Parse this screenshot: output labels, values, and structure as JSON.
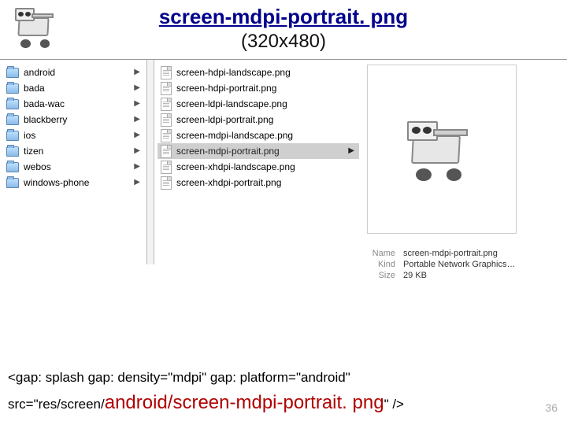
{
  "header": {
    "title": "screen-mdpi-portrait. png",
    "subtitle": "(320x480)"
  },
  "finder": {
    "folders": [
      {
        "name": "android"
      },
      {
        "name": "bada"
      },
      {
        "name": "bada-wac"
      },
      {
        "name": "blackberry"
      },
      {
        "name": "ios"
      },
      {
        "name": "tizen"
      },
      {
        "name": "webos"
      },
      {
        "name": "windows-phone"
      }
    ],
    "files": [
      {
        "name": "screen-hdpi-landscape.png",
        "selected": false
      },
      {
        "name": "screen-hdpi-portrait.png",
        "selected": false
      },
      {
        "name": "screen-ldpi-landscape.png",
        "selected": false
      },
      {
        "name": "screen-ldpi-portrait.png",
        "selected": false
      },
      {
        "name": "screen-mdpi-landscape.png",
        "selected": false
      },
      {
        "name": "screen-mdpi-portrait.png",
        "selected": true
      },
      {
        "name": "screen-xhdpi-landscape.png",
        "selected": false
      },
      {
        "name": "screen-xhdpi-portrait.png",
        "selected": false
      }
    ],
    "preview": {
      "name_label": "Name",
      "name_value": "screen-mdpi-portrait.png",
      "kind_label": "Kind",
      "kind_value": "Portable Network Graphics…",
      "size_label": "Size",
      "size_value": "29 KB"
    }
  },
  "code": {
    "line1": "<gap: splash gap: density=\"mdpi\" gap: platform=\"android\"",
    "prefix": "src=\"res/screen/",
    "highlight": "android/screen-mdpi-portrait. png",
    "suffix": "\" />"
  },
  "page_number": "36"
}
